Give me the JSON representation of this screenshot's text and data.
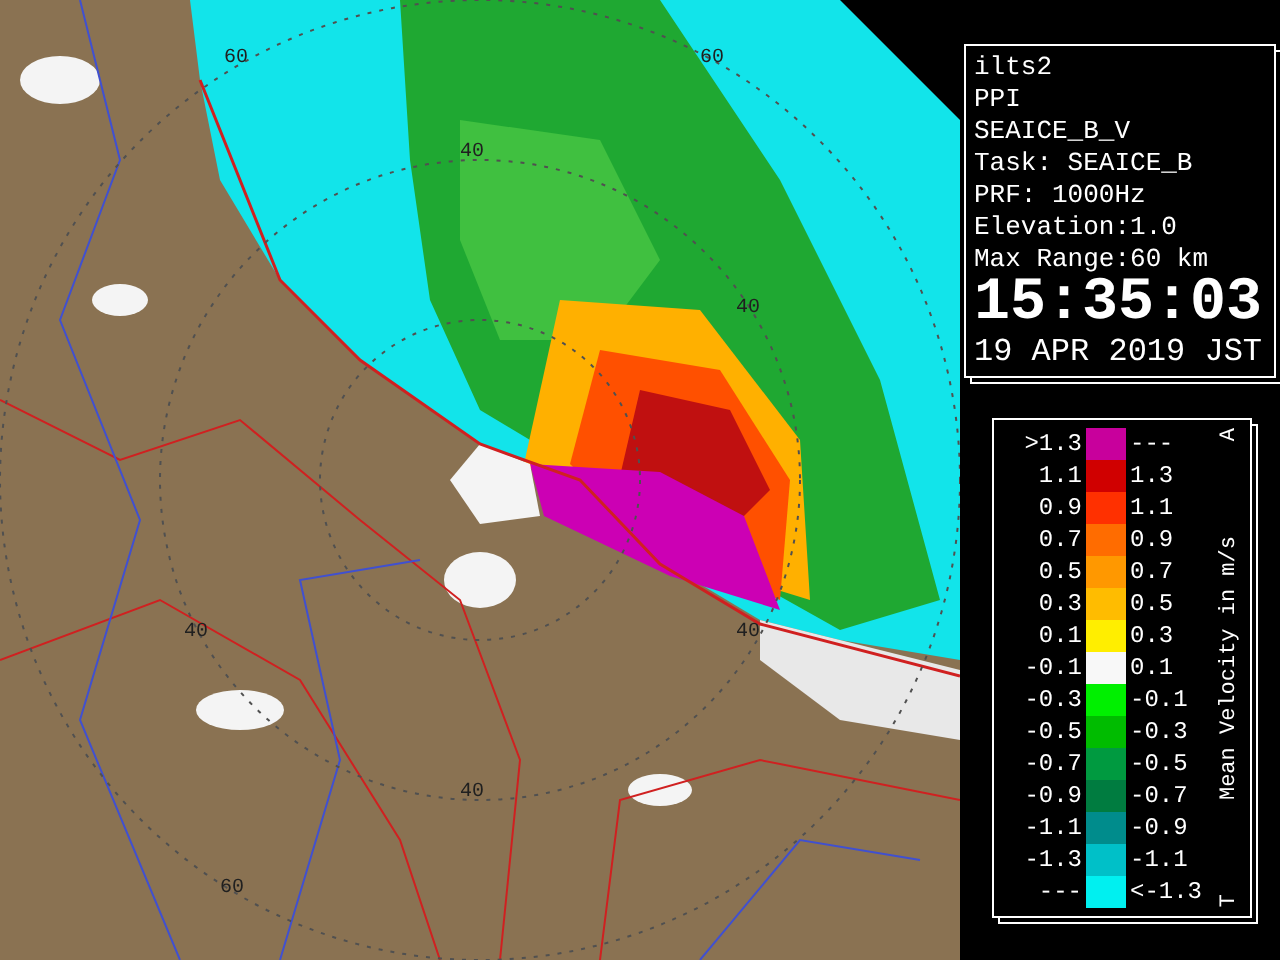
{
  "map": {
    "range_labels": [
      {
        "text": "60"
      },
      {
        "text": "60"
      },
      {
        "text": "40"
      },
      {
        "text": "40"
      },
      {
        "text": "40"
      },
      {
        "text": "40"
      },
      {
        "text": "40"
      },
      {
        "text": "60"
      }
    ]
  },
  "info": {
    "lines": [
      "ilts2",
      "PPI",
      "SEAICE_B_V",
      "Task: SEAICE_B",
      "PRF: 1000Hz",
      "Elevation:1.0",
      "Max Range:60 km"
    ],
    "time": "15:35:03",
    "date": "19 APR 2019 JST"
  },
  "legend": {
    "title": "Mean Velocity in m/s",
    "top_mark": "A",
    "bottom_mark": "T",
    "rows": [
      {
        "low": ">1.3",
        "high": "---",
        "color": "#c8009c"
      },
      {
        "low": "1.1",
        "high": "1.3",
        "color": "#d00000"
      },
      {
        "low": "0.9",
        "high": "1.1",
        "color": "#ff3000"
      },
      {
        "low": "0.7",
        "high": "0.9",
        "color": "#ff6c00"
      },
      {
        "low": "0.5",
        "high": "0.7",
        "color": "#ff9800"
      },
      {
        "low": "0.3",
        "high": "0.5",
        "color": "#ffbc00"
      },
      {
        "low": "0.1",
        "high": "0.3",
        "color": "#ffee00"
      },
      {
        "low": "-0.1",
        "high": "0.1",
        "color": "#f8f8f8"
      },
      {
        "low": "-0.3",
        "high": "-0.1",
        "color": "#00f000"
      },
      {
        "low": "-0.5",
        "high": "-0.3",
        "color": "#00bc00"
      },
      {
        "low": "-0.7",
        "high": "-0.5",
        "color": "#009a40"
      },
      {
        "low": "-0.9",
        "high": "-0.7",
        "color": "#007c40"
      },
      {
        "low": "-1.1",
        "high": "-0.9",
        "color": "#008c8c"
      },
      {
        "low": "-1.3",
        "high": "-1.1",
        "color": "#00c0c8"
      },
      {
        "low": "---",
        "high": "<-1.3",
        "color": "#00f0f0"
      }
    ]
  }
}
